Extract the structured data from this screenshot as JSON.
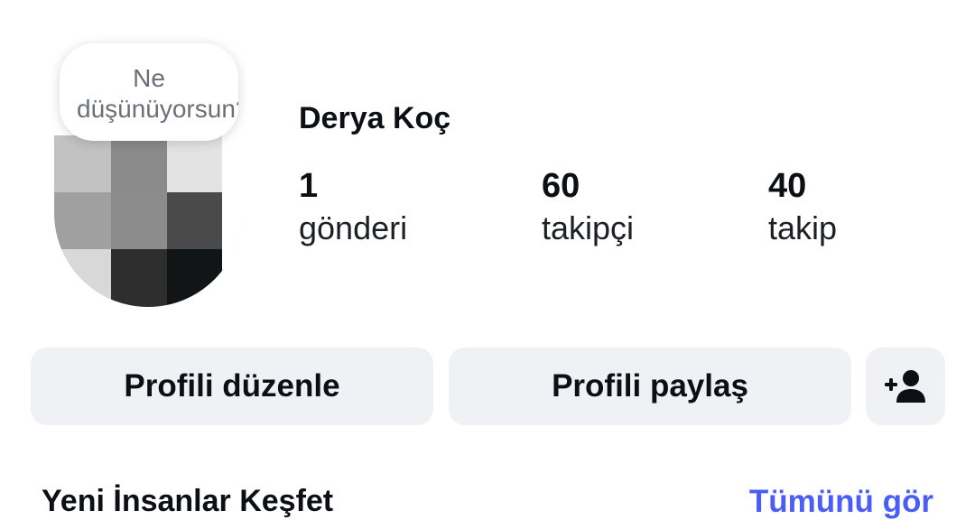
{
  "note": {
    "text": "Ne düşünüyorsun?"
  },
  "profile": {
    "name": "Derya Koç",
    "avatar_blocks": [
      "#c2c2c2",
      "#8a8a8a",
      "#e3e3e3",
      "#a0a0a0",
      "#8c8c8c",
      "#4a4a4a",
      "#d8d8d8",
      "#2e2e2e",
      "#121518"
    ]
  },
  "stats": {
    "posts": {
      "value": "1",
      "label": "gönderi"
    },
    "followers": {
      "value": "60",
      "label": "takipçi"
    },
    "following": {
      "value": "40",
      "label": "takip"
    }
  },
  "actions": {
    "edit_profile": "Profili düzenle",
    "share_profile": "Profili paylaş",
    "add_person_icon": "person-add-icon"
  },
  "discover": {
    "title": "Yeni İnsanlar Keşfet",
    "see_all": "Tümünü gör"
  },
  "colors": {
    "link": "#4a5df9",
    "button_bg": "#eff1f5",
    "text": "#0c0f14"
  }
}
